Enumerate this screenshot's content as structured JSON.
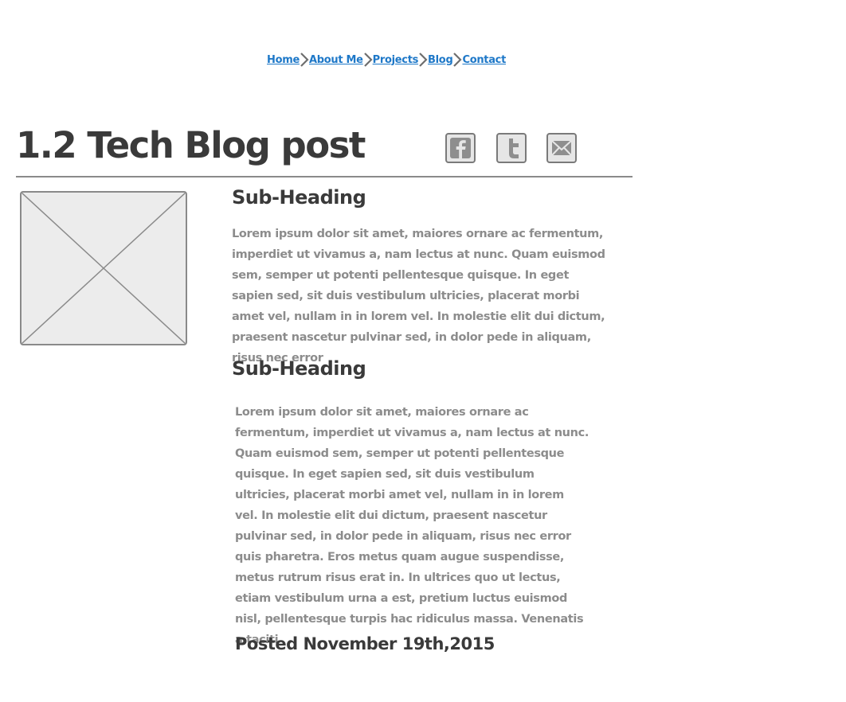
{
  "nav": {
    "items": [
      "Home",
      "About Me",
      "Projects",
      "Blog",
      "Contact"
    ]
  },
  "post": {
    "title": "1.2 Tech Blog post",
    "sections": [
      {
        "heading": "Sub-Heading",
        "text": "Lorem ipsum dolor sit amet, maiores ornare ac fermentum, imperdiet ut vivamus a, nam lectus at nunc. Quam euismod sem, semper ut potenti pellentesque quisque. In eget sapien sed, sit duis vestibulum ultricies, placerat morbi amet vel, nullam in in lorem vel. In molestie elit dui dictum, praesent nascetur pulvinar sed, in dolor pede in aliquam, risus nec error"
      },
      {
        "heading": "Sub-Heading",
        "text": "Lorem ipsum dolor sit amet, maiores ornare ac fermentum, imperdiet ut vivamus a, nam lectus at nunc. Quam euismod sem, semper ut potenti pellentesque quisque. In eget sapien sed, sit duis vestibulum ultricies, placerat morbi amet vel, nullam in in lorem vel. In molestie elit dui dictum, praesent nascetur pulvinar sed, in dolor pede in aliquam, risus nec error quis pharetra. Eros metus quam augue suspendisse, metus rutrum risus erat in.  In ultrices quo ut lectus, etiam vestibulum urna a est, pretium luctus euismod nisl, pellentesque turpis hac ridiculus massa. Venenatis a taciti"
      }
    ],
    "posted": "Posted November 19th,2015"
  },
  "social": {
    "icons": [
      "facebook-icon",
      "twitter-icon",
      "mail-icon"
    ]
  },
  "colors": {
    "link": "#1e78c8",
    "heading": "#3a3a3a",
    "body_text": "#8c8c8c",
    "placeholder_fill": "#ececec",
    "border": "#8a8a8a"
  }
}
